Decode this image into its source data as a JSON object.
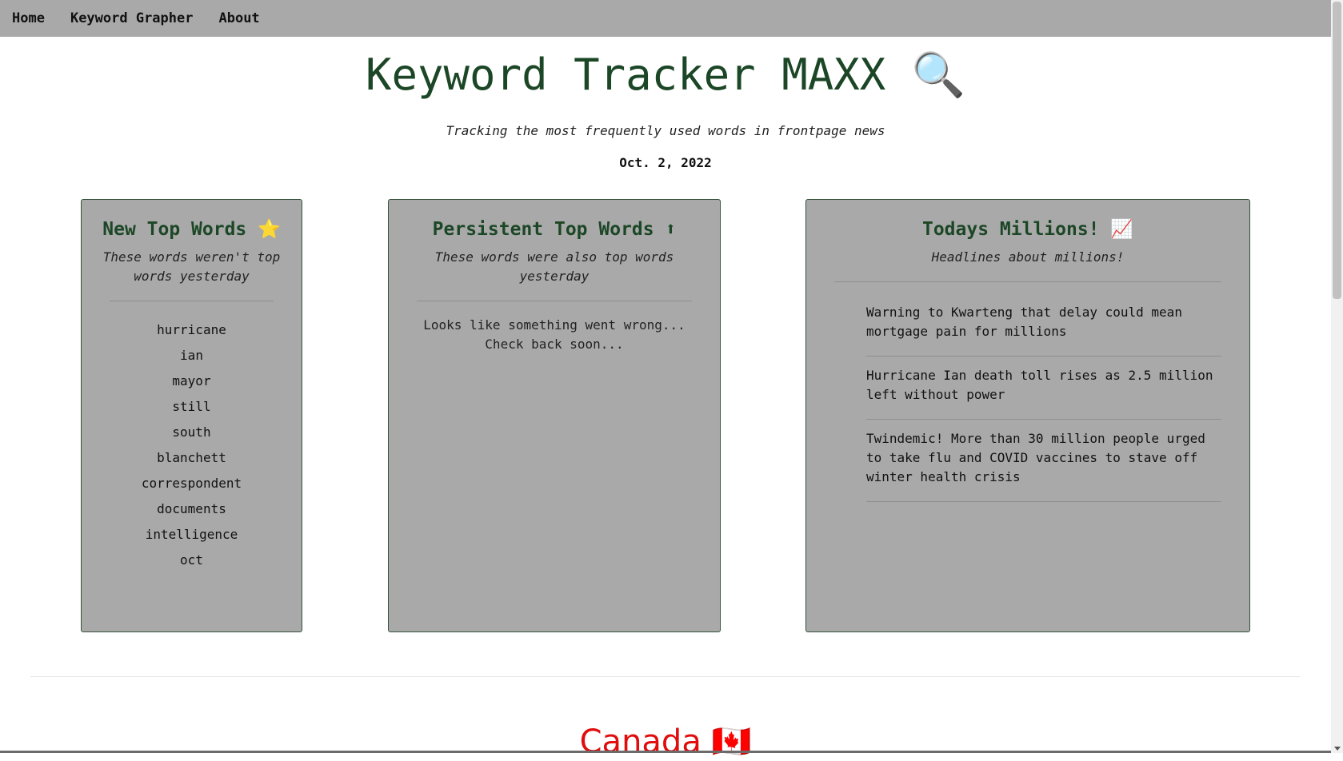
{
  "nav": {
    "items": [
      {
        "label": "Home"
      },
      {
        "label": "Keyword Grapher"
      },
      {
        "label": "About"
      }
    ]
  },
  "header": {
    "title": "Keyword Tracker MAXX 🔍",
    "subtitle": "Tracking the most frequently used words in frontpage news",
    "date": "Oct. 2, 2022"
  },
  "new_top_words": {
    "title": "New Top Words ⭐",
    "subtitle": "These words weren't top words yesterday",
    "words": [
      "hurricane",
      "ian",
      "mayor",
      "still",
      "south",
      "blanchett",
      "correspondent",
      "documents",
      "intelligence",
      "oct"
    ]
  },
  "persistent_top_words": {
    "title": "Persistent Top Words ⬆",
    "subtitle": "These words were also top words yesterday",
    "error_message": "Looks like something went wrong... Check back soon..."
  },
  "todays_millions": {
    "title": "Todays Millions! 📈",
    "subtitle": "Headlines about millions!",
    "headlines": [
      "Warning to Kwarteng that delay could mean mortgage pain for millions",
      "Hurricane Ian death toll rises as 2.5 million left without power",
      "Twindemic! More than 30 million people urged to take flu and COVID vaccines to stave off winter health crisis"
    ]
  },
  "next_section": {
    "title": "Canada 🇨🇦"
  },
  "colors": {
    "nav_bg": "#a9a9a9",
    "card_bg": "#a9a9a9",
    "heading_green": "#1c4726",
    "country_red": "#e10d0d"
  }
}
